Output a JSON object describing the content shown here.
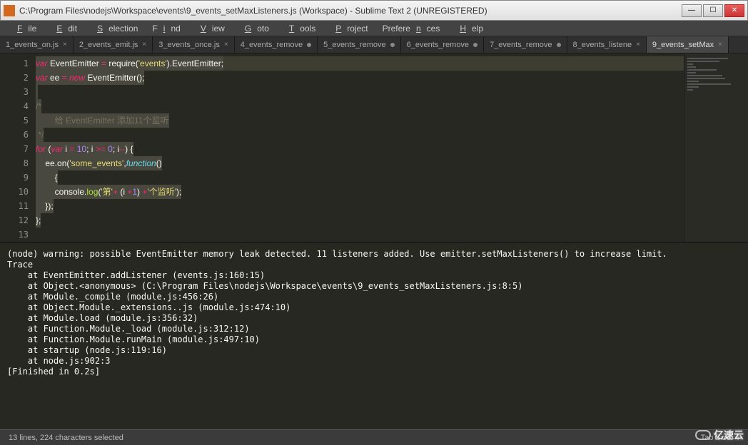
{
  "window": {
    "title": "C:\\Program Files\\nodejs\\Workspace\\events\\9_events_setMaxListeners.js (Workspace) - Sublime Text 2 (UNREGISTERED)"
  },
  "menu": [
    "File",
    "Edit",
    "Selection",
    "Find",
    "View",
    "Goto",
    "Tools",
    "Project",
    "Preferences",
    "Help"
  ],
  "tabs": [
    {
      "label": "1_events_on.js",
      "dirty": false
    },
    {
      "label": "2_events_emit.js",
      "dirty": false
    },
    {
      "label": "3_events_once.js",
      "dirty": false
    },
    {
      "label": "4_events_remove",
      "dirty": true
    },
    {
      "label": "5_events_remove",
      "dirty": true
    },
    {
      "label": "6_events_remove",
      "dirty": true
    },
    {
      "label": "7_events_remove",
      "dirty": true
    },
    {
      "label": "8_events_listene",
      "dirty": false
    },
    {
      "label": "9_events_setMax",
      "dirty": false,
      "active": true
    }
  ],
  "code": {
    "lines": [
      1,
      2,
      3,
      4,
      5,
      6,
      7,
      8,
      9,
      10,
      11,
      12,
      13
    ],
    "l1_var": "var",
    "l1_a": " EventEmitter ",
    "l1_eq": "=",
    "l1_b": " require(",
    "l1_str": "'events'",
    "l1_c": ").EventEmitter;",
    "l2_var": "var",
    "l2_a": " ee ",
    "l2_eq": "=",
    "l2_new": " new",
    "l2_b": " EventEmitter();",
    "l3": "",
    "l4": "/*",
    "l5": "        给 EventEmitter 添加11个监听",
    "l6": " */",
    "l7_for": "for",
    "l7_a": " (",
    "l7_var": "var",
    "l7_b": " i ",
    "l7_eq": "=",
    "l7_c": " ",
    "l7_n10": "10",
    "l7_d": "; i ",
    "l7_ge": ">=",
    "l7_e": " ",
    "l7_n0": "0",
    "l7_f": "; i",
    "l7_dec": "--",
    "l7_g": ") {",
    "l8_a": "    ee.on(",
    "l8_str": "'some_events'",
    "l8_b": ",",
    "l8_fn": "function",
    "l8_c": "()",
    "l9": "        {",
    "l10_a": "        console.",
    "l10_log": "log",
    "l10_b": "(",
    "l10_s1": "'第'",
    "l10_p1": "+",
    "l10_c": " (i ",
    "l10_p2": "+",
    "l10_n1": "1",
    "l10_d": ") ",
    "l10_p3": "+",
    "l10_s2": "'个监听'",
    "l10_e": ");",
    "l11": "    });",
    "l12": "};"
  },
  "console": "(node) warning: possible EventEmitter memory leak detected. 11 listeners added. Use emitter.setMaxListeners() to increase limit.\nTrace\n    at EventEmitter.addListener (events.js:160:15)\n    at Object.<anonymous> (C:\\Program Files\\nodejs\\Workspace\\events\\9_events_setMaxListeners.js:8:5)\n    at Module._compile (module.js:456:26)\n    at Object.Module._extensions..js (module.js:474:10)\n    at Module.load (module.js:356:32)\n    at Function.Module._load (module.js:312:12)\n    at Function.Module.runMain (module.js:497:10)\n    at startup (node.js:119:16)\n    at node.js:902:3\n[Finished in 0.2s]",
  "status": {
    "left": "13 lines, 224 characters selected",
    "tabsize": "Tab Size: 4"
  },
  "watermark": "亿速云"
}
